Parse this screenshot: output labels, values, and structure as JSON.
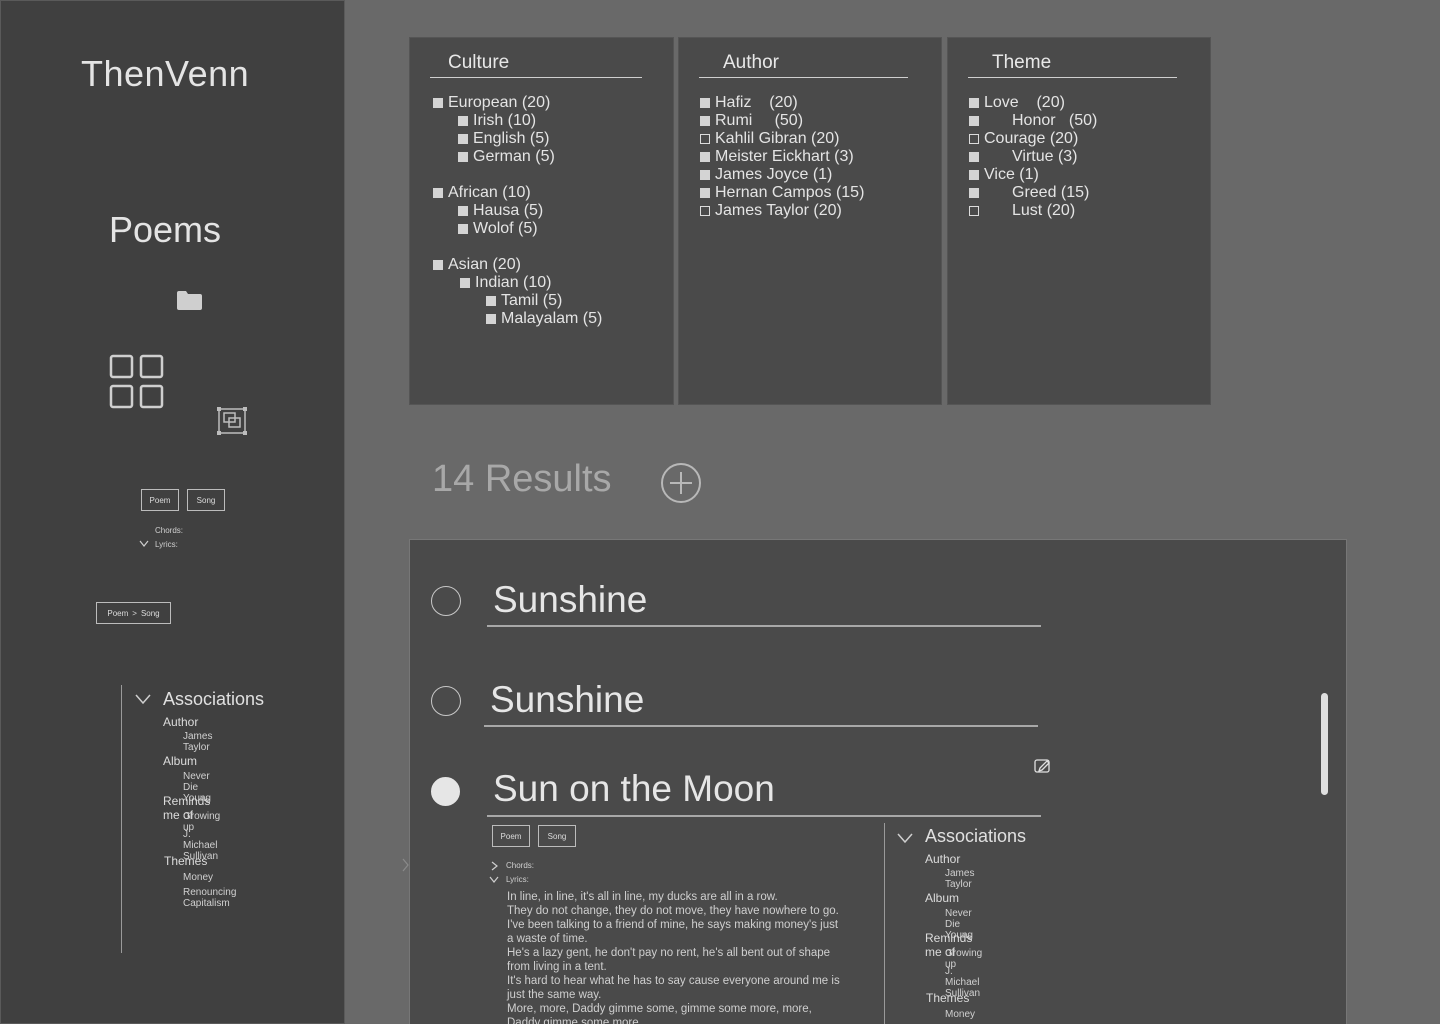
{
  "app": {
    "title": "ThenVenn",
    "section": "Poems"
  },
  "sidebar": {
    "buttons": [
      "Poem",
      "Song"
    ],
    "chords_label": "Chords:",
    "lyrics_label": "Lyrics:",
    "breadcrumb": [
      "Poem",
      ">",
      "Song"
    ],
    "associations": {
      "title": "Associations",
      "groups": [
        {
          "label": "Author",
          "values": [
            "James Taylor"
          ]
        },
        {
          "label": "Album",
          "values": [
            "Never Die Young"
          ]
        },
        {
          "label": "Reminds me of",
          "values": [
            "Growing up",
            "J. Michael Sullivan"
          ]
        },
        {
          "label": "Themes",
          "values": [
            "Money",
            "Renouncing Capitalism"
          ]
        }
      ]
    }
  },
  "filters": {
    "culture": {
      "title": "Culture",
      "items": [
        {
          "label": "European (20)",
          "checked": true
        },
        {
          "label": "Irish (10)",
          "checked": true
        },
        {
          "label": "English (5)",
          "checked": true
        },
        {
          "label": "German (5)",
          "checked": true
        },
        {
          "label": "African (10)",
          "checked": true
        },
        {
          "label": "Hausa (5)",
          "checked": true
        },
        {
          "label": "Wolof (5)",
          "checked": true
        },
        {
          "label": "Asian (20)",
          "checked": true
        },
        {
          "label": "Indian (10)",
          "checked": true
        },
        {
          "label": "Tamil (5)",
          "checked": true
        },
        {
          "label": "Malayalam (5)",
          "checked": true
        }
      ]
    },
    "author": {
      "title": "Author",
      "items": [
        {
          "label": "Hafiz    (20)",
          "checked": true
        },
        {
          "label": "Rumi     (50)",
          "checked": true
        },
        {
          "label": "Kahlil Gibran (20)",
          "checked": false
        },
        {
          "label": "Meister Eickhart (3)",
          "checked": true
        },
        {
          "label": "James Joyce (1)",
          "checked": true
        },
        {
          "label": "Hernan Campos (15)",
          "checked": true
        },
        {
          "label": "James Taylor (20)",
          "checked": false
        }
      ]
    },
    "theme": {
      "title": "Theme",
      "items": [
        {
          "label": "Love    (20)",
          "checked": true
        },
        {
          "label": "Honor   (50)",
          "checked": true
        },
        {
          "label": "Courage (20)",
          "checked": false
        },
        {
          "label": "Virtue (3)",
          "checked": true
        },
        {
          "label": "Vice (1)",
          "checked": true
        },
        {
          "label": "Greed (15)",
          "checked": true
        },
        {
          "label": "Lust (20)",
          "checked": false
        }
      ]
    }
  },
  "results": {
    "count_label": "14 Results",
    "items": [
      {
        "title": "Sunshine",
        "selected": false
      },
      {
        "title": "Sunshine",
        "selected": false
      },
      {
        "title": "Sun on the Moon",
        "selected": true
      }
    ],
    "detail": {
      "buttons": [
        "Poem",
        "Song"
      ],
      "chords_label": "Chords:",
      "lyrics_label": "Lyrics:",
      "lyrics": [
        "In line, in line, it's all in line, my ducks are all in a row.",
        "They do not change, they do not move, they have nowhere to go.",
        "I've been talking to a friend of mine, he says making money's just",
        "a waste of time.",
        "He's a lazy gent, he don't pay no rent, he's all bent out of shape",
        "from living in a tent.",
        "It's hard to hear what he has to say cause everyone around me is",
        "just the same way.",
        "More, more, Daddy gimme some, gimme some more, more,",
        "Daddy gimme some more"
      ],
      "associations": {
        "title": "Associations",
        "groups": [
          {
            "label": "Author",
            "values": [
              "James Taylor"
            ]
          },
          {
            "label": "Album",
            "values": [
              "Never Die Young"
            ]
          },
          {
            "label": "Reminds me of",
            "values": [
              "Growing up",
              "J. Michael Sullivan"
            ]
          },
          {
            "label": "Themes",
            "values": [
              "Money"
            ]
          }
        ]
      }
    }
  }
}
